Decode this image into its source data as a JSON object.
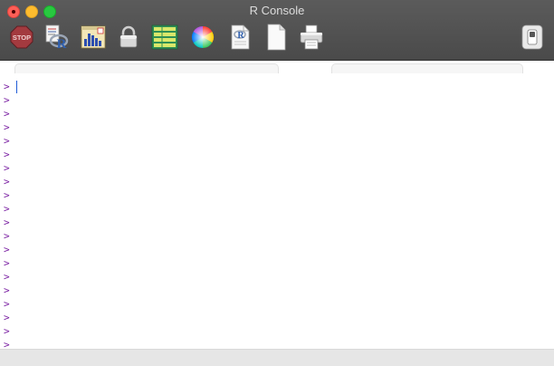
{
  "window": {
    "title": "R Console"
  },
  "toolbar": {
    "items": [
      {
        "name": "stop-button",
        "icon": "stop-sign-icon",
        "label": "STOP"
      },
      {
        "name": "source-script-button",
        "icon": "r-script-icon"
      },
      {
        "name": "quartz-graphics-button",
        "icon": "bar-chart-icon"
      },
      {
        "name": "authenticate-button",
        "icon": "lock-icon"
      },
      {
        "name": "data-editor-button",
        "icon": "spreadsheet-icon"
      },
      {
        "name": "color-picker-button",
        "icon": "color-wheel-icon"
      },
      {
        "name": "new-r-document-button",
        "icon": "r-document-icon"
      },
      {
        "name": "new-blank-document-button",
        "icon": "blank-page-icon"
      },
      {
        "name": "print-button",
        "icon": "printer-icon"
      },
      {
        "name": "toggle-toolbar-button",
        "icon": "toggle-switch-icon"
      }
    ]
  },
  "console": {
    "prompt": ">",
    "prompt_count": 20
  },
  "colors": {
    "prompt": "#7a1fa2",
    "cursor": "#1f5bd6",
    "titlebar": "#4f4f4f"
  }
}
